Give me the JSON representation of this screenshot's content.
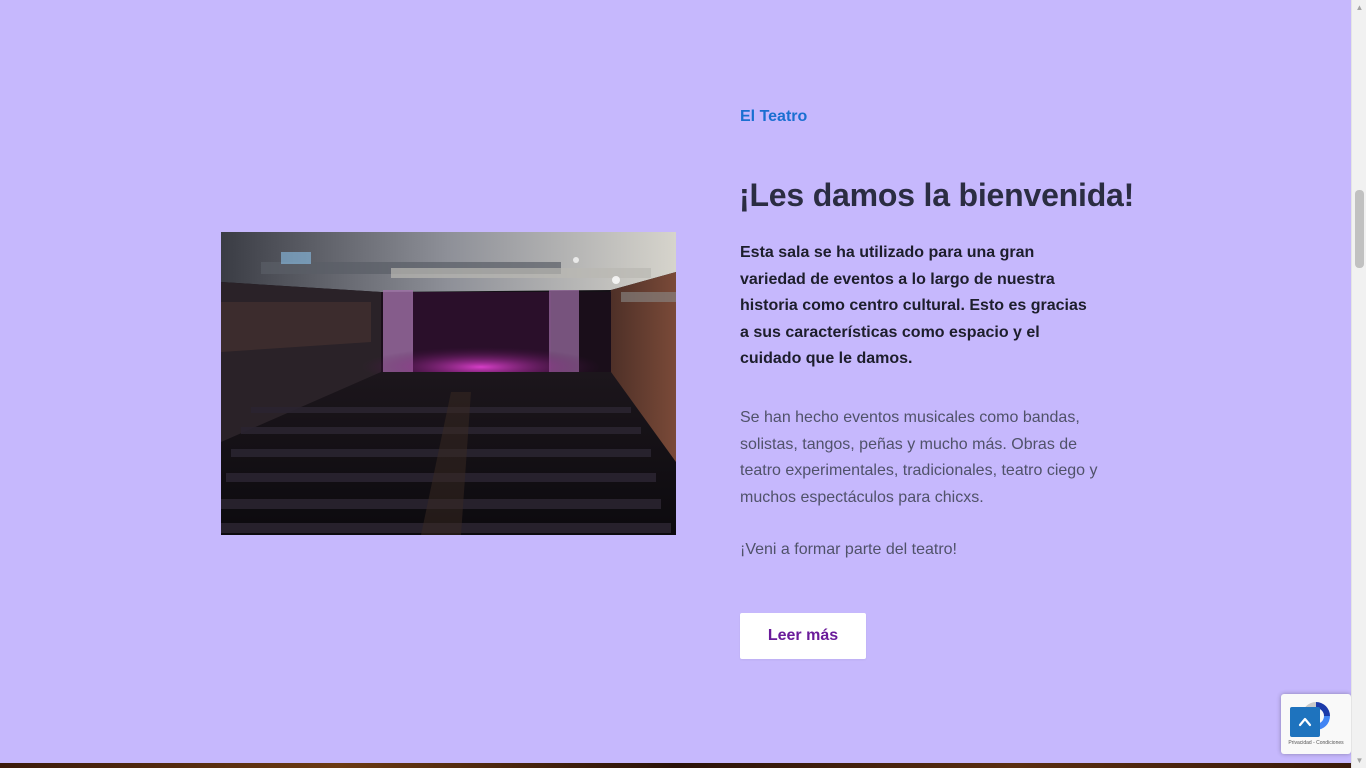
{
  "section": {
    "eyebrow": "El Teatro",
    "headline": "¡Les damos la bienvenida!",
    "lead": "Esta sala se ha utilizado para una gran variedad de eventos a lo largo de nuestra historia como centro cultural. Esto es gracias a sus características como espacio y el cuidado que le damos.",
    "body_paragraph": "Se han hecho eventos musicales como bandas, solistas, tangos, peñas y mucho más. Obras de teatro experimentales, tradicionales, teatro ciego y muchos espectáculos para chicxs.",
    "call_to_action_text": "¡Veni a formar parte del teatro!",
    "button_label": "Leer más"
  },
  "recaptcha": {
    "footer_text": "Privacidad - Condiciones"
  },
  "icons": {
    "back_to_top": "chevron-up-icon",
    "recaptcha": "recaptcha-logo-icon"
  },
  "colors": {
    "background": "#c6b8fd",
    "eyebrow": "#1a6fd1",
    "headline": "#2b2d42",
    "button_text": "#6a1b9a",
    "back_to_top": "#1e73be"
  }
}
